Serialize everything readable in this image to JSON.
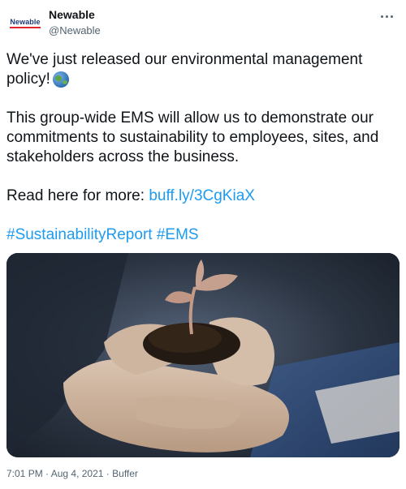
{
  "author": {
    "display_name": "Newable",
    "handle": "@Newable",
    "avatar_text": "Newable"
  },
  "tweet": {
    "line1": "We've just released our environmental management",
    "line2": "policy!",
    "line2_emoji": "globe-icon",
    "paragraph2": "This group-wide EMS will allow us to demonstrate our commitments to sustainability to employees, sites, and stakeholders across the business.",
    "read_more_prefix": "Read here for more: ",
    "link": "buff.ly/3CgKiaX",
    "hashtag1": "#SustainabilityReport",
    "hashtag2": "#EMS"
  },
  "media": {
    "description_icon": "image-hands-seedling"
  },
  "meta": {
    "time": "7:01 PM",
    "separator": "·",
    "date": "Aug 4, 2021",
    "source": "Buffer"
  },
  "colors": {
    "link": "#1d9bf0",
    "text": "#0f1419",
    "secondary": "#536471"
  }
}
